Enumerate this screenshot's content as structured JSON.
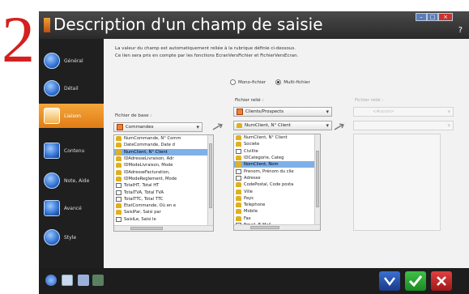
{
  "step_number": "2",
  "window": {
    "title": "Description d'un champ de saisie",
    "help": "?"
  },
  "sidebar": {
    "items": [
      {
        "label": "Général",
        "icon": "general-icon"
      },
      {
        "label": "Détail",
        "icon": "detail-icon"
      },
      {
        "label": "Liaison",
        "icon": "link-icon",
        "active": true
      },
      {
        "label": "Contenu",
        "icon": "content-icon"
      },
      {
        "label": "Note, Aide",
        "icon": "note-help-icon"
      },
      {
        "label": "Avancé",
        "icon": "advanced-icon"
      },
      {
        "label": "Style",
        "icon": "style-icon"
      }
    ]
  },
  "content": {
    "description_line1": "La valeur du champ est automatiquement reliée à la rubrique définie ci-dessous.",
    "description_line2": "Ce lien sera pris en compte par les fonctions EcranVersFichier et FichierVersEcran.",
    "radio_mono": "Mono-fichier",
    "radio_multi": "Multi-fichier",
    "base_label": "Fichier de base :",
    "base_combo": "Commandes",
    "linked_label": "Fichier relié :",
    "linked_combo": "Clients/Prospects",
    "linked_key_combo": "NumClient, N° Client",
    "linked2_label": "Fichier relié :",
    "linked2_combo": "<Aucun>",
    "base_list": [
      {
        "text": "NumCommande, N° Comm",
        "icon": "key"
      },
      {
        "text": "DateCommande, Date d",
        "icon": "key"
      },
      {
        "text": "NumClient, N° Client",
        "icon": "key",
        "selected": true
      },
      {
        "text": "IDAdresseLivraison, Adr",
        "icon": "key"
      },
      {
        "text": "IDModeLivraison, Mode",
        "icon": "key"
      },
      {
        "text": "IDAdresseFacturation,",
        "icon": "key"
      },
      {
        "text": "IDModeReglement, Mode",
        "icon": "key"
      },
      {
        "text": "TotalHT, Total HT",
        "icon": "field"
      },
      {
        "text": "TotalTVA, Total TVA",
        "icon": "field"
      },
      {
        "text": "TotalTTC, Total TTC",
        "icon": "field"
      },
      {
        "text": "EtatCommande, Où en e",
        "icon": "key"
      },
      {
        "text": "SaisiPar, Saisi par",
        "icon": "key"
      },
      {
        "text": "SaisiLe, Saisi le",
        "icon": "field"
      }
    ],
    "linked_list": [
      {
        "text": "NumClient, N° Client",
        "icon": "key"
      },
      {
        "text": "Societe",
        "icon": "key"
      },
      {
        "text": "Civilite",
        "icon": "field"
      },
      {
        "text": "IDCategorie, Categ",
        "icon": "key"
      },
      {
        "text": "NomClient, Nom",
        "icon": "key",
        "selected": true
      },
      {
        "text": "Prenom, Prénom du clie",
        "icon": "field"
      },
      {
        "text": "Adresse",
        "icon": "field"
      },
      {
        "text": "CodePostal, Code posta",
        "icon": "key"
      },
      {
        "text": "Ville",
        "icon": "key"
      },
      {
        "text": "Pays",
        "icon": "key"
      },
      {
        "text": "Telephone",
        "icon": "key"
      },
      {
        "text": "Mobile",
        "icon": "key"
      },
      {
        "text": "Fax",
        "icon": "key"
      },
      {
        "text": "Email, E-Mail",
        "icon": "field"
      }
    ]
  },
  "colors": {
    "accent": "#e8881c",
    "selection": "#7fb0e8",
    "step_number": "#d42020",
    "ok": "#2aa030",
    "cancel": "#c82828",
    "restore": "#2a5ab8"
  }
}
